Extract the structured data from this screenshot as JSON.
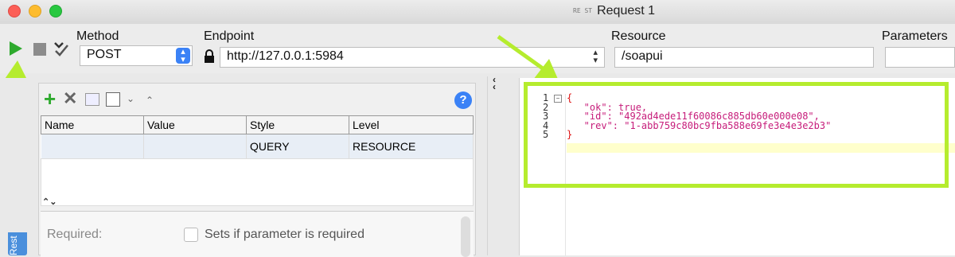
{
  "window": {
    "title": "Request 1",
    "title_icon_text": "RE ST"
  },
  "toolbar": {
    "method_label": "Method",
    "method_value": "POST",
    "endpoint_label": "Endpoint",
    "endpoint_value": "http://127.0.0.1:5984",
    "resource_label": "Resource",
    "resource_value": "/soapui",
    "parameters_label": "Parameters"
  },
  "params": {
    "columns": [
      "Name",
      "Value",
      "Style",
      "Level"
    ],
    "rows": [
      {
        "name": "",
        "value": "",
        "style": "QUERY",
        "level": "RESOURCE"
      }
    ],
    "collapse_glyph": "⌃⌄",
    "required_label": "Required:",
    "required_checkbox_label": "Sets if parameter is required"
  },
  "side_tab_text": "Rest",
  "response": {
    "line_numbers": [
      "1",
      "2",
      "3",
      "4",
      "5"
    ],
    "lines": [
      "{",
      "   \"ok\": true,",
      "   \"id\": \"492ad4ede11f60086c885db60e000e08\",",
      "   \"rev\": \"1-abb759c80bc9fba588e69fe3e4e3e2b3\"",
      "}"
    ]
  },
  "colors": {
    "accent_green": "#b5ec2e",
    "play_green": "#2eaa2e",
    "json_key": "#c61c7a"
  }
}
